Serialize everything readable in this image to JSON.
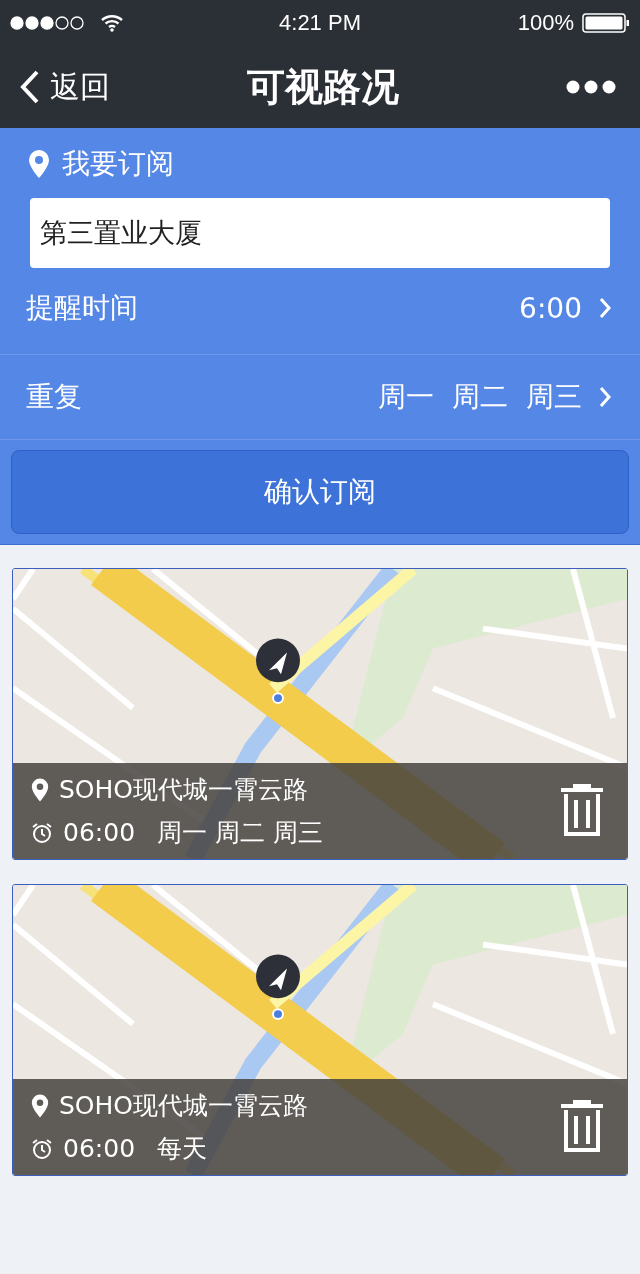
{
  "status_bar": {
    "time": "4:21 PM",
    "battery": "100%"
  },
  "nav": {
    "back": "返回",
    "title": "可视路况"
  },
  "form": {
    "heading": "我要订阅",
    "location": "第三置业大厦",
    "rows": [
      {
        "label": "提醒时间",
        "value": "6:00"
      },
      {
        "label": "重复",
        "value": "周一  周二  周三"
      }
    ],
    "confirm": "确认订阅"
  },
  "subscriptions": [
    {
      "place": "SOHO现代城一霄云路",
      "time": "06:00",
      "days": "周一 周二 周三"
    },
    {
      "place": "SOHO现代城一霄云路",
      "time": "06:00",
      "days": "每天"
    }
  ]
}
